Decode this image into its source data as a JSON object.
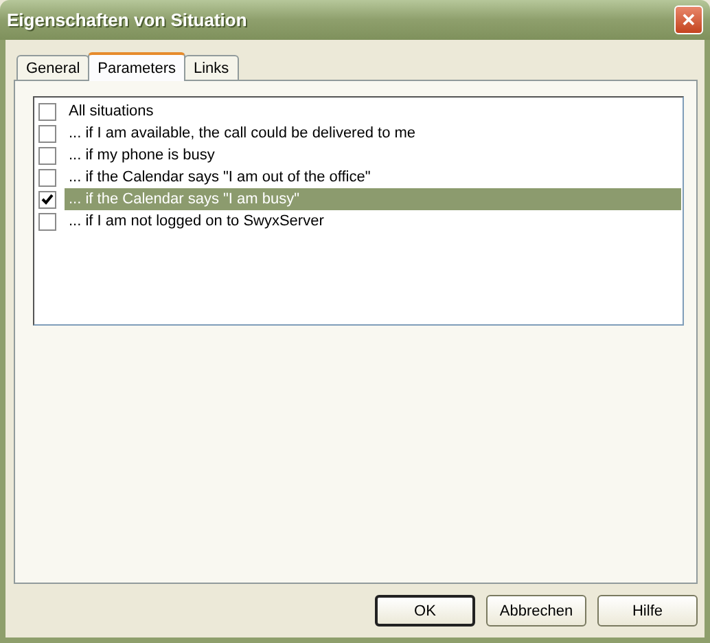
{
  "window": {
    "title": "Eigenschaften von Situation",
    "close": "✕"
  },
  "tabs": [
    {
      "label": "General",
      "selected": false
    },
    {
      "label": "Parameters",
      "selected": true
    },
    {
      "label": "Links",
      "selected": false
    }
  ],
  "situations": [
    {
      "label": "All situations",
      "checked": false,
      "selected": false
    },
    {
      "label": "... if I am available, the call could be delivered to me",
      "checked": false,
      "selected": false
    },
    {
      "label": "... if my phone is busy",
      "checked": false,
      "selected": false
    },
    {
      "label": "... if the Calendar says \"I am out of the office\"",
      "checked": false,
      "selected": false
    },
    {
      "label": "... if the Calendar says \"I am busy\"",
      "checked": true,
      "selected": true
    },
    {
      "label": "... if I am not logged on to SwyxServer",
      "checked": false,
      "selected": false
    }
  ],
  "buttons": [
    {
      "label": "OK",
      "default": true
    },
    {
      "label": "Abbrechen",
      "default": false
    },
    {
      "label": "Hilfe",
      "default": false
    }
  ]
}
